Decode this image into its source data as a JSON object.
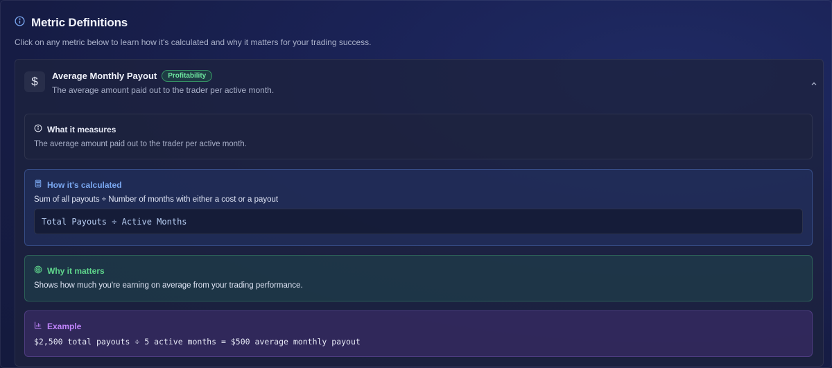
{
  "header": {
    "title": "Metric Definitions",
    "subtitle": "Click on any metric below to learn how it's calculated and why it matters for your trading success.",
    "icon": "info-icon"
  },
  "metric": {
    "icon": "dollar-icon",
    "symbol": "$",
    "title": "Average Monthly Payout",
    "badge": "Profitability",
    "description": "The average amount paid out to the trader per active month.",
    "expanded": true
  },
  "sections": {
    "measures": {
      "title": "What it measures",
      "text": "The average amount paid out to the trader per active month.",
      "icon": "info-icon"
    },
    "calculation": {
      "title": "How it's calculated",
      "text": "Sum of all payouts ÷ Number of months with either a cost or a payout",
      "formula": "Total Payouts ÷ Active Months",
      "icon": "calculator-icon"
    },
    "why": {
      "title": "Why it matters",
      "text": "Shows how much you're earning on average from your trading performance.",
      "icon": "target-icon"
    },
    "example": {
      "title": "Example",
      "text": "$2,500 total payouts ÷ 5 active months = $500 average monthly payout",
      "icon": "bar-chart-icon"
    }
  },
  "colors": {
    "calc_accent": "#7aa7f0",
    "why_accent": "#5fd68c",
    "example_accent": "#c084fc",
    "badge_accent": "#6ee7a0"
  }
}
